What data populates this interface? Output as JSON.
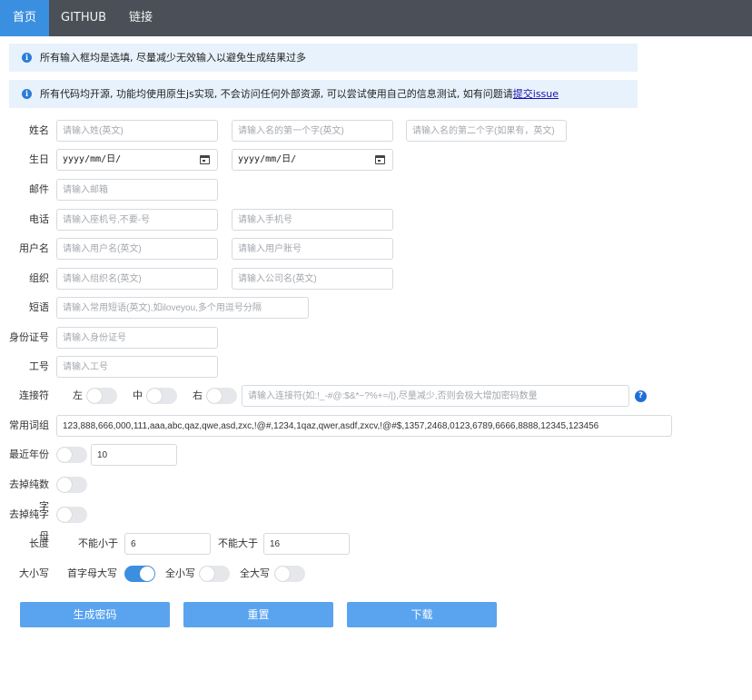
{
  "nav": {
    "home": "首页",
    "github": "GITHUB",
    "links": "链接"
  },
  "notices": {
    "n1": "所有输入框均是选填, 尽量减少无效输入以避免生成结果过多",
    "n2_prefix": "所有代码均开源, 功能均使用原生js实现, 不会访问任何外部资源, 可以尝试使用自己的信息测试, 如有问题请",
    "n2_link": "提交issue"
  },
  "form": {
    "name": {
      "label": "姓名",
      "last_placeholder": "请输入姓(英文)",
      "first1_placeholder": "请输入名的第一个字(英文)",
      "first2_placeholder": "请输入名的第二个字(如果有，英文)"
    },
    "birthday": {
      "label": "生日",
      "date1": "yyyy/mm/日/",
      "date2": "yyyy/mm/日/"
    },
    "email": {
      "label": "邮件",
      "placeholder": "请输入邮箱"
    },
    "phone": {
      "label": "电话",
      "landline_placeholder": "请输入座机号,不要-号",
      "mobile_placeholder": "请输入手机号"
    },
    "username": {
      "label": "用户名",
      "name_placeholder": "请输入用户名(英文)",
      "account_placeholder": "请输入用户账号"
    },
    "org": {
      "label": "组织",
      "org_placeholder": "请输入组织名(英文)",
      "company_placeholder": "请输入公司名(英文)"
    },
    "phrase": {
      "label": "短语",
      "placeholder": "请输入常用短语(英文),如iloveyou,多个用逗号分隔"
    },
    "idcard": {
      "label": "身份证号",
      "placeholder": "请输入身份证号"
    },
    "employee": {
      "label": "工号",
      "placeholder": "请输入工号"
    },
    "connector": {
      "label": "连接符",
      "left": "左",
      "middle": "中",
      "right": "右",
      "placeholder": "请输入连接符(如:!_-#@:$&*~?%+=/|),尽量减少,否则会极大增加密码数量",
      "help": "?"
    },
    "common_words": {
      "label": "常用词组",
      "value": "123,888,666,000,111,aaa,abc,qaz,qwe,asd,zxc,!@#,1234,1qaz,qwer,asdf,zxcv,!@#$,1357,2468,0123,6789,6666,8888,12345,123456"
    },
    "recent_years": {
      "label": "最近年份",
      "value": "10"
    },
    "remove_digits": {
      "label": "去掉纯数字"
    },
    "remove_letters": {
      "label": "去掉纯字母"
    },
    "length": {
      "label": "长度",
      "min_label": "不能小于",
      "min_value": "6",
      "max_label": "不能大于",
      "max_value": "16"
    },
    "case": {
      "label": "大小写",
      "capitalize": "首字母大写",
      "lower": "全小写",
      "upper": "全大写"
    }
  },
  "buttons": {
    "generate": "生成密码",
    "reset": "重置",
    "download": "下载"
  },
  "colors": {
    "accent": "#3b8fe0",
    "button": "#5aa4ef",
    "topbar": "#4a4f58",
    "notice_bg": "#e8f2fc"
  }
}
